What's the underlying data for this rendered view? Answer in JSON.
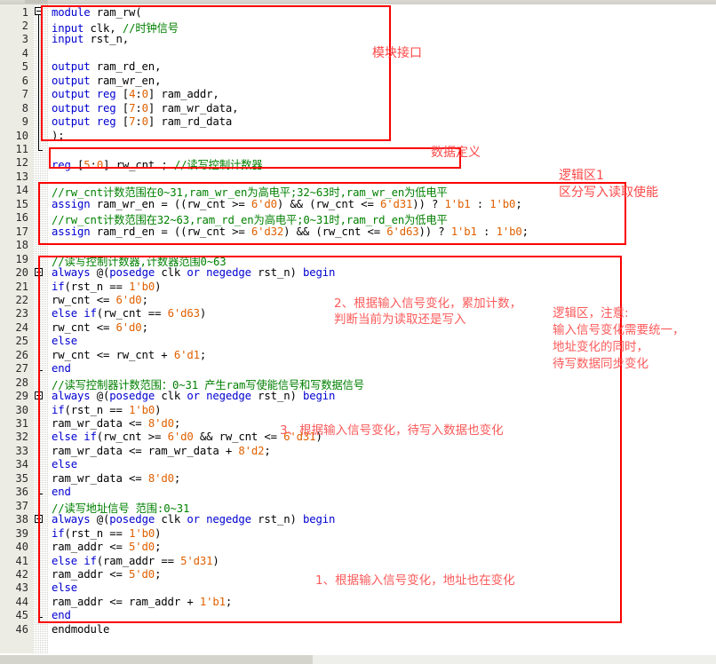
{
  "app": {
    "type": "code-editor",
    "language": "Verilog",
    "module_name": "ram_rw",
    "total_lines": 46
  },
  "colors": {
    "keyword": "#0000d0",
    "comment": "#008000",
    "number": "#e06000",
    "plain": "#000000",
    "annotation": "#fb5a5a",
    "annotation_box": "#fa0000",
    "gutter_bg": "#ecece4",
    "code_bg": "#ffffff"
  },
  "lines": [
    {
      "n": "1",
      "tokens": [
        {
          "t": "module",
          "c": "kw"
        },
        {
          "t": " ram_rw(",
          "c": "pn"
        }
      ]
    },
    {
      "n": "2",
      "tokens": [
        {
          "t": "    ",
          "c": "pn"
        },
        {
          "t": "input",
          "c": "kw"
        },
        {
          "t": "                   clk,          ",
          "c": "pn"
        },
        {
          "t": "//时钟信号",
          "c": "cm"
        }
      ]
    },
    {
      "n": "3",
      "tokens": [
        {
          "t": "    ",
          "c": "pn"
        },
        {
          "t": "input",
          "c": "kw"
        },
        {
          "t": "                   rst_n,",
          "c": "pn"
        }
      ]
    },
    {
      "n": "4",
      "tokens": []
    },
    {
      "n": "5",
      "tokens": [
        {
          "t": "    ",
          "c": "pn"
        },
        {
          "t": "output",
          "c": "kw"
        },
        {
          "t": "                  ram_rd_en,",
          "c": "pn"
        }
      ]
    },
    {
      "n": "6",
      "tokens": [
        {
          "t": "    ",
          "c": "pn"
        },
        {
          "t": "output",
          "c": "kw"
        },
        {
          "t": "                  ram_wr_en,",
          "c": "pn"
        }
      ]
    },
    {
      "n": "7",
      "tokens": [
        {
          "t": "    ",
          "c": "pn"
        },
        {
          "t": "output reg",
          "c": "kw"
        },
        {
          "t": " [",
          "c": "pn"
        },
        {
          "t": "4",
          "c": "num"
        },
        {
          "t": ":",
          "c": "pn"
        },
        {
          "t": "0",
          "c": "num"
        },
        {
          "t": "]     ram_addr,",
          "c": "pn"
        }
      ]
    },
    {
      "n": "8",
      "tokens": [
        {
          "t": "    ",
          "c": "pn"
        },
        {
          "t": "output reg",
          "c": "kw"
        },
        {
          "t": " [",
          "c": "pn"
        },
        {
          "t": "7",
          "c": "num"
        },
        {
          "t": ":",
          "c": "pn"
        },
        {
          "t": "0",
          "c": "num"
        },
        {
          "t": "]     ram_wr_data,",
          "c": "pn"
        }
      ]
    },
    {
      "n": "9",
      "tokens": [
        {
          "t": "    ",
          "c": "pn"
        },
        {
          "t": "output reg",
          "c": "kw"
        },
        {
          "t": " [",
          "c": "pn"
        },
        {
          "t": "7",
          "c": "num"
        },
        {
          "t": ":",
          "c": "pn"
        },
        {
          "t": "0",
          "c": "num"
        },
        {
          "t": "]     ram_rd_data",
          "c": "pn"
        }
      ]
    },
    {
      "n": "10",
      "tokens": [
        {
          "t": ");",
          "c": "pn"
        }
      ]
    },
    {
      "n": "11",
      "tokens": []
    },
    {
      "n": "12",
      "tokens": [
        {
          "t": "reg",
          "c": "kw"
        },
        {
          "t": "     [",
          "c": "pn"
        },
        {
          "t": "5",
          "c": "num"
        },
        {
          "t": ":",
          "c": "pn"
        },
        {
          "t": "0",
          "c": "num"
        },
        {
          "t": "]  rw_cnt ;                  ",
          "c": "pn"
        },
        {
          "t": "//读写控制计数器",
          "c": "cm"
        }
      ]
    },
    {
      "n": "13",
      "tokens": []
    },
    {
      "n": "14",
      "tokens": [
        {
          "t": "//rw_cnt计数范围在0~31,ram_wr_en为高电平;32~63时,ram_wr_en为低电平",
          "c": "cm"
        }
      ]
    },
    {
      "n": "15",
      "tokens": [
        {
          "t": "assign",
          "c": "kw"
        },
        {
          "t": "  ram_wr_en = ((rw_cnt >= ",
          "c": "pn"
        },
        {
          "t": "6'd0",
          "c": "num"
        },
        {
          "t": ") && (rw_cnt <= ",
          "c": "pn"
        },
        {
          "t": "6'd31",
          "c": "num"
        },
        {
          "t": "))  ?  ",
          "c": "pn"
        },
        {
          "t": "1'b1",
          "c": "num"
        },
        {
          "t": "  :  ",
          "c": "pn"
        },
        {
          "t": "1'b0",
          "c": "num"
        },
        {
          "t": ";",
          "c": "pn"
        }
      ]
    },
    {
      "n": "16",
      "tokens": [
        {
          "t": "//rw_cnt计数范围在32~63,ram_rd_en为高电平;0~31时,ram_rd_en为低电平",
          "c": "cm"
        }
      ]
    },
    {
      "n": "17",
      "tokens": [
        {
          "t": "assign",
          "c": "kw"
        },
        {
          "t": "  ram_rd_en = ((rw_cnt >= ",
          "c": "pn"
        },
        {
          "t": "6'd32",
          "c": "num"
        },
        {
          "t": ") && (rw_cnt <= ",
          "c": "pn"
        },
        {
          "t": "6'd63",
          "c": "num"
        },
        {
          "t": "))  ?  ",
          "c": "pn"
        },
        {
          "t": "1'b1",
          "c": "num"
        },
        {
          "t": "  :  ",
          "c": "pn"
        },
        {
          "t": "1'b0",
          "c": "num"
        },
        {
          "t": ";",
          "c": "pn"
        }
      ]
    },
    {
      "n": "18",
      "tokens": []
    },
    {
      "n": "19",
      "tokens": [
        {
          "t": "//读写控制计数器,计数器范围",
          "c": "cm"
        },
        {
          "t": "0~63",
          "c": "cm"
        }
      ]
    },
    {
      "n": "20",
      "tokens": [
        {
          "t": "always",
          "c": "kw"
        },
        {
          "t": " @(",
          "c": "pn"
        },
        {
          "t": "posedge",
          "c": "kw"
        },
        {
          "t": " clk ",
          "c": "pn"
        },
        {
          "t": "or",
          "c": "kw"
        },
        {
          "t": " ",
          "c": "pn"
        },
        {
          "t": "negedge",
          "c": "kw"
        },
        {
          "t": " rst_n) ",
          "c": "pn"
        },
        {
          "t": "begin",
          "c": "kw"
        }
      ]
    },
    {
      "n": "21",
      "tokens": [
        {
          "t": "    ",
          "c": "pn"
        },
        {
          "t": "if",
          "c": "kw"
        },
        {
          "t": "(rst_n == ",
          "c": "pn"
        },
        {
          "t": "1'b0",
          "c": "num"
        },
        {
          "t": ")",
          "c": "pn"
        }
      ]
    },
    {
      "n": "22",
      "tokens": [
        {
          "t": "        rw_cnt <= ",
          "c": "pn"
        },
        {
          "t": "6'd0",
          "c": "num"
        },
        {
          "t": ";",
          "c": "pn"
        }
      ]
    },
    {
      "n": "23",
      "tokens": [
        {
          "t": "    ",
          "c": "pn"
        },
        {
          "t": "else if",
          "c": "kw"
        },
        {
          "t": "(rw_cnt == ",
          "c": "pn"
        },
        {
          "t": "6'd63",
          "c": "num"
        },
        {
          "t": ")",
          "c": "pn"
        }
      ]
    },
    {
      "n": "24",
      "tokens": [
        {
          "t": "        rw_cnt <= ",
          "c": "pn"
        },
        {
          "t": "6'd0",
          "c": "num"
        },
        {
          "t": ";",
          "c": "pn"
        }
      ]
    },
    {
      "n": "25",
      "tokens": [
        {
          "t": "    ",
          "c": "pn"
        },
        {
          "t": "else",
          "c": "kw"
        }
      ]
    },
    {
      "n": "26",
      "tokens": [
        {
          "t": "        rw_cnt <= rw_cnt + ",
          "c": "pn"
        },
        {
          "t": "6'd1",
          "c": "num"
        },
        {
          "t": ";",
          "c": "pn"
        }
      ]
    },
    {
      "n": "27",
      "tokens": [
        {
          "t": "end",
          "c": "kw"
        }
      ]
    },
    {
      "n": "28",
      "tokens": [
        {
          "t": "//读写控制器计数范围：",
          "c": "cm"
        },
        {
          "t": "0~31",
          "c": "cm"
        },
        {
          "t": " 产生ram写使能信号和写数据信号",
          "c": "cm"
        }
      ]
    },
    {
      "n": "29",
      "tokens": [
        {
          "t": "always",
          "c": "kw"
        },
        {
          "t": " @(",
          "c": "pn"
        },
        {
          "t": "posedge",
          "c": "kw"
        },
        {
          "t": " clk ",
          "c": "pn"
        },
        {
          "t": "or",
          "c": "kw"
        },
        {
          "t": " ",
          "c": "pn"
        },
        {
          "t": "negedge",
          "c": "kw"
        },
        {
          "t": " rst_n) ",
          "c": "pn"
        },
        {
          "t": "begin",
          "c": "kw"
        }
      ]
    },
    {
      "n": "30",
      "tokens": [
        {
          "t": "    ",
          "c": "pn"
        },
        {
          "t": "if",
          "c": "kw"
        },
        {
          "t": "(rst_n == ",
          "c": "pn"
        },
        {
          "t": "1'b0",
          "c": "num"
        },
        {
          "t": ")",
          "c": "pn"
        }
      ]
    },
    {
      "n": "31",
      "tokens": [
        {
          "t": "        ram_wr_data <= ",
          "c": "pn"
        },
        {
          "t": "8'd0",
          "c": "num"
        },
        {
          "t": ";",
          "c": "pn"
        }
      ]
    },
    {
      "n": "32",
      "tokens": [
        {
          "t": "    ",
          "c": "pn"
        },
        {
          "t": "else if",
          "c": "kw"
        },
        {
          "t": "(rw_cnt >= ",
          "c": "pn"
        },
        {
          "t": "6'd0",
          "c": "num"
        },
        {
          "t": " && rw_cnt <= ",
          "c": "pn"
        },
        {
          "t": "6'd31",
          "c": "num"
        },
        {
          "t": ")",
          "c": "pn"
        }
      ]
    },
    {
      "n": "33",
      "tokens": [
        {
          "t": "        ram_wr_data <= ram_wr_data + ",
          "c": "pn"
        },
        {
          "t": "8'd2",
          "c": "num"
        },
        {
          "t": ";",
          "c": "pn"
        }
      ]
    },
    {
      "n": "34",
      "tokens": [
        {
          "t": "    ",
          "c": "pn"
        },
        {
          "t": "else",
          "c": "kw"
        }
      ]
    },
    {
      "n": "35",
      "tokens": [
        {
          "t": "        ram_wr_data <= ",
          "c": "pn"
        },
        {
          "t": "8'd0",
          "c": "num"
        },
        {
          "t": ";",
          "c": "pn"
        }
      ]
    },
    {
      "n": "36",
      "tokens": [
        {
          "t": "end",
          "c": "kw"
        }
      ]
    },
    {
      "n": "37",
      "tokens": [
        {
          "t": "//读写地址信号 范围:",
          "c": "cm"
        },
        {
          "t": "0~31",
          "c": "cm"
        }
      ]
    },
    {
      "n": "38",
      "tokens": [
        {
          "t": "always",
          "c": "kw"
        },
        {
          "t": " @(",
          "c": "pn"
        },
        {
          "t": "posedge",
          "c": "kw"
        },
        {
          "t": " clk ",
          "c": "pn"
        },
        {
          "t": "or",
          "c": "kw"
        },
        {
          "t": " ",
          "c": "pn"
        },
        {
          "t": "negedge",
          "c": "kw"
        },
        {
          "t": " rst_n) ",
          "c": "pn"
        },
        {
          "t": "begin",
          "c": "kw"
        }
      ]
    },
    {
      "n": "39",
      "tokens": [
        {
          "t": "    ",
          "c": "pn"
        },
        {
          "t": "if",
          "c": "kw"
        },
        {
          "t": "(rst_n == ",
          "c": "pn"
        },
        {
          "t": "1'b0",
          "c": "num"
        },
        {
          "t": ")",
          "c": "pn"
        }
      ]
    },
    {
      "n": "40",
      "tokens": [
        {
          "t": "        ram_addr <= ",
          "c": "pn"
        },
        {
          "t": "5'd0",
          "c": "num"
        },
        {
          "t": ";",
          "c": "pn"
        }
      ]
    },
    {
      "n": "41",
      "tokens": [
        {
          "t": "    ",
          "c": "pn"
        },
        {
          "t": "else if",
          "c": "kw"
        },
        {
          "t": "(ram_addr == ",
          "c": "pn"
        },
        {
          "t": "5'd31",
          "c": "num"
        },
        {
          "t": ")",
          "c": "pn"
        }
      ]
    },
    {
      "n": "42",
      "tokens": [
        {
          "t": "        ram_addr <= ",
          "c": "pn"
        },
        {
          "t": "5'd0",
          "c": "num"
        },
        {
          "t": ";",
          "c": "pn"
        }
      ]
    },
    {
      "n": "43",
      "tokens": [
        {
          "t": "    ",
          "c": "pn"
        },
        {
          "t": "else",
          "c": "kw"
        }
      ]
    },
    {
      "n": "44",
      "tokens": [
        {
          "t": "        ram_addr <= ram_addr + ",
          "c": "pn"
        },
        {
          "t": "1'b1",
          "c": "num"
        },
        {
          "t": ";",
          "c": "pn"
        }
      ]
    },
    {
      "n": "45",
      "tokens": [
        {
          "t": "end",
          "c": "kw"
        }
      ]
    },
    {
      "n": "46",
      "tokens": [
        {
          "t": "endmodule",
          "c": "pn"
        }
      ]
    }
  ],
  "annotations": {
    "module_interface": "模块接口",
    "data_definition": "数据定义",
    "logic_zone_1_title": "逻辑区1",
    "logic_zone_1_desc": "区分写入读取使能",
    "note_2": "2、根据输入信号变化，累加计数，\n判断当前为读取还是写入",
    "note_3": "3、根据输入信号变化，待写入数据也变化",
    "note_1": "1、根据输入信号变化，地址也在变化",
    "logic_zone_note": "逻辑区，注意:\n输入信号变化需要统一，\n地址变化的同时，\n待写数据同步变化"
  }
}
